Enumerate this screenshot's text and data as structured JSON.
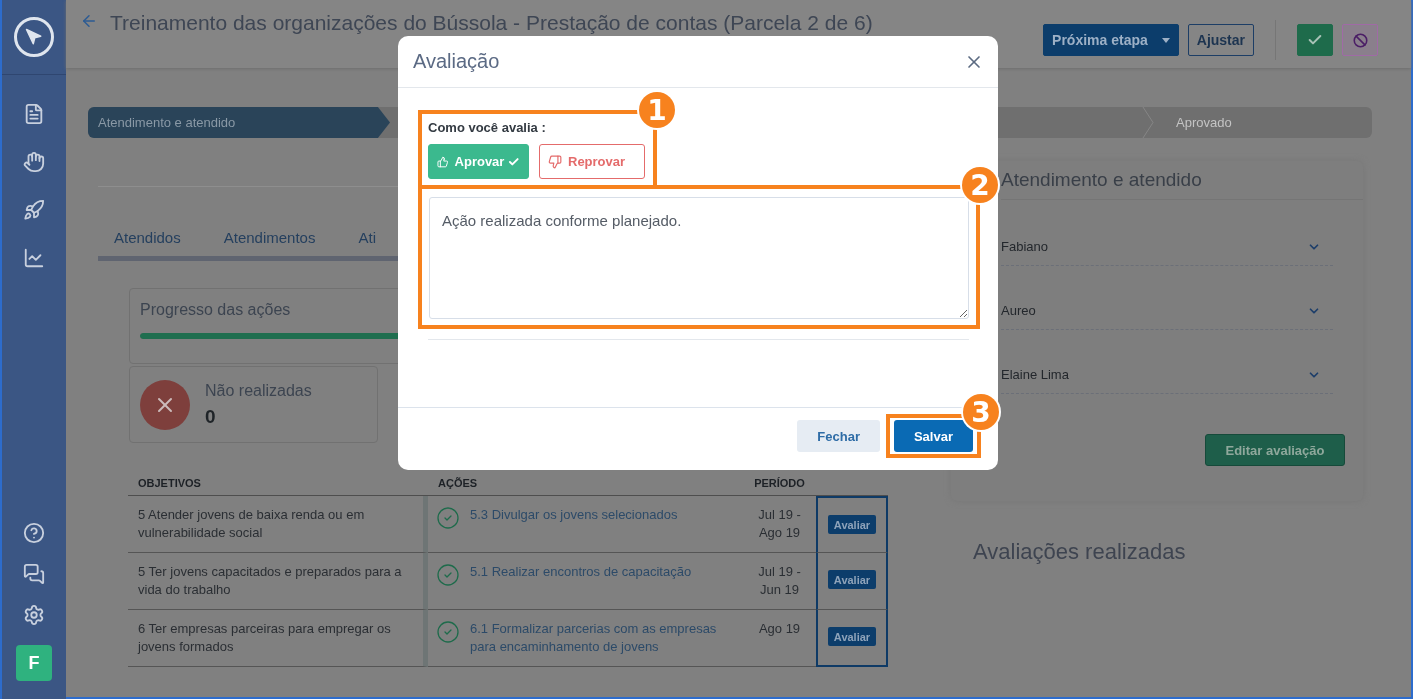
{
  "sidebar": {
    "avatar": "F"
  },
  "header": {
    "title": "Treinamento das organizações do Bússola - Prestação de contas (Parcela 2 de 6)",
    "buttons": [
      {
        "label": "Próxima etapa",
        "kind": "dropdown"
      },
      {
        "label": "Ajustar",
        "kind": "outline"
      }
    ]
  },
  "stepper": [
    {
      "label": "Atendimento e atendido",
      "active": true
    },
    {
      "label": "Aprovado",
      "active": false
    }
  ],
  "tabs": [
    {
      "label": "Atendidos"
    },
    {
      "label": "Atendimentos"
    },
    {
      "label": "Ati"
    }
  ],
  "progress": {
    "title": "Progresso das ações",
    "level": 1
  },
  "summary": {
    "label": "Não realizadas",
    "count": "0"
  },
  "table": {
    "columns": [
      "OBJETIVOS",
      "AÇÕES",
      "PERÍODO"
    ],
    "rows": [
      {
        "objective": "5 Atender jovens de baixa renda ou em vulnerabilidade social",
        "action": "5.3 Divulgar os jovens selecionados",
        "done": true,
        "period": "Jul 19 - Ago 19",
        "button": "Avaliar"
      },
      {
        "objective": "5 Ter jovens capacitados e preparados para a vida do trabalho",
        "action": "5.1 Realizar encontros de capacitação",
        "done": true,
        "period": "Jul 19 - Jun 19",
        "button": "Avaliar"
      },
      {
        "objective": "6 Ter empresas parceiras para empregar os jovens formados",
        "action": "6.1 Formalizar parcerias com as empresas para encaminhamento de jovens",
        "done": true,
        "period": "Ago 19",
        "button": "Avaliar"
      }
    ]
  },
  "right_panel": {
    "title": "Atendimento e atendido",
    "selects": [
      "Fabiano",
      "Aureo",
      "Elaine Lima"
    ],
    "button": "Editar avaliação"
  },
  "evaluations_title": "Avaliações realizadas",
  "modal": {
    "title": "Avaliação",
    "question": "Como você avalia :",
    "choices": [
      {
        "label": "Aprovar",
        "kind": "approve",
        "selected": true
      },
      {
        "label": "Reprovar",
        "kind": "reject",
        "selected": false
      }
    ],
    "comment": "Ação realizada conforme planejado.",
    "buttons": [
      {
        "label": "Fechar",
        "kind": "secondary"
      },
      {
        "label": "Salvar",
        "kind": "primary"
      }
    ],
    "annotations": [
      "1",
      "2",
      "3"
    ]
  }
}
